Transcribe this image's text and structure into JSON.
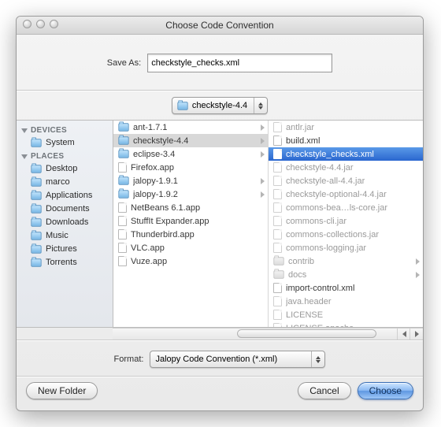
{
  "window": {
    "title": "Choose Code Convention"
  },
  "saveas": {
    "label": "Save As:",
    "value": "checkstyle_checks.xml"
  },
  "path_popup": {
    "label": "checkstyle-4.4"
  },
  "sidebar": {
    "sections": [
      {
        "title": "DEVICES",
        "items": [
          {
            "label": "System"
          }
        ]
      },
      {
        "title": "PLACES",
        "items": [
          {
            "label": "Desktop"
          },
          {
            "label": "marco"
          },
          {
            "label": "Applications"
          },
          {
            "label": "Documents"
          },
          {
            "label": "Downloads"
          },
          {
            "label": "Music"
          },
          {
            "label": "Pictures"
          },
          {
            "label": "Torrents"
          }
        ]
      }
    ]
  },
  "column1": [
    {
      "name": "ant-1.7.1",
      "kind": "folder",
      "has_children": true
    },
    {
      "name": "checkstyle-4.4",
      "kind": "folder",
      "has_children": true,
      "selected": true
    },
    {
      "name": "eclipse-3.4",
      "kind": "folder",
      "has_children": true
    },
    {
      "name": "Firefox.app",
      "kind": "app"
    },
    {
      "name": "jalopy-1.9.1",
      "kind": "folder",
      "has_children": true
    },
    {
      "name": "jalopy-1.9.2",
      "kind": "folder",
      "has_children": true
    },
    {
      "name": "NetBeans 6.1.app",
      "kind": "app"
    },
    {
      "name": "StuffIt Expander.app",
      "kind": "app"
    },
    {
      "name": "Thunderbird.app",
      "kind": "app"
    },
    {
      "name": "VLC.app",
      "kind": "app"
    },
    {
      "name": "Vuze.app",
      "kind": "app"
    }
  ],
  "column2": [
    {
      "name": "antlr.jar",
      "kind": "file",
      "dim": true
    },
    {
      "name": "build.xml",
      "kind": "file"
    },
    {
      "name": "checkstyle_checks.xml",
      "kind": "file",
      "selected": true
    },
    {
      "name": "checkstyle-4.4.jar",
      "kind": "file",
      "dim": true
    },
    {
      "name": "checkstyle-all-4.4.jar",
      "kind": "file",
      "dim": true
    },
    {
      "name": "checkstyle-optional-4.4.jar",
      "kind": "file",
      "dim": true
    },
    {
      "name": "commons-bea…ls-core.jar",
      "kind": "file",
      "dim": true
    },
    {
      "name": "commons-cli.jar",
      "kind": "file",
      "dim": true
    },
    {
      "name": "commons-collections.jar",
      "kind": "file",
      "dim": true
    },
    {
      "name": "commons-logging.jar",
      "kind": "file",
      "dim": true
    },
    {
      "name": "contrib",
      "kind": "folder",
      "dim": true,
      "has_children": true
    },
    {
      "name": "docs",
      "kind": "folder",
      "dim": true,
      "has_children": true
    },
    {
      "name": "import-control.xml",
      "kind": "file"
    },
    {
      "name": "java.header",
      "kind": "file",
      "dim": true
    },
    {
      "name": "LICENSE",
      "kind": "file",
      "dim": true
    },
    {
      "name": "LICENSE.apache",
      "kind": "file",
      "dim": true
    }
  ],
  "format": {
    "label": "Format:",
    "value": "Jalopy Code Convention (*.xml)"
  },
  "buttons": {
    "new_folder": "New Folder",
    "cancel": "Cancel",
    "choose": "Choose"
  }
}
